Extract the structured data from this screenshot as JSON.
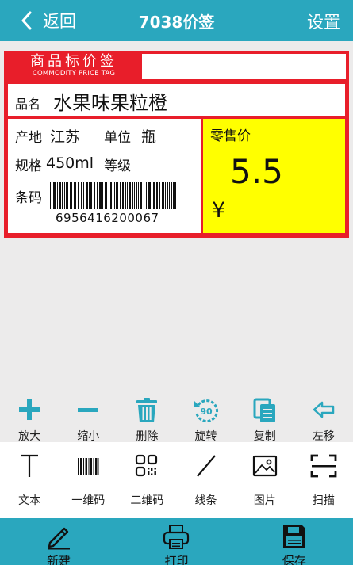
{
  "header": {
    "back_label": "返回",
    "title": "7038价签",
    "settings_label": "设置"
  },
  "tag": {
    "header_cn": "商品标价签",
    "header_en": "COMMODITY PRICE TAG",
    "name_label": "品名",
    "name_value": "水果味果粒橙",
    "origin_label": "产地",
    "origin_value": "江苏",
    "unit_label": "单位",
    "unit_value": "瓶",
    "spec_label": "规格",
    "spec_value": "450ml",
    "grade_label": "等级",
    "barcode_label": "条码",
    "barcode_digits": "6956416200067",
    "price_label": "零售价",
    "price_value": "5.5",
    "currency_symbol": "¥"
  },
  "edit_toolbar": [
    {
      "label": "放大",
      "icon": "plus-icon"
    },
    {
      "label": "缩小",
      "icon": "minus-icon"
    },
    {
      "label": "删除",
      "icon": "trash-icon"
    },
    {
      "label": "旋转",
      "icon": "rotate-90-icon",
      "badge": "90"
    },
    {
      "label": "复制",
      "icon": "copy-icon"
    },
    {
      "label": "左移",
      "icon": "arrow-left-icon"
    }
  ],
  "insert_toolbar": [
    {
      "label": "文本",
      "icon": "text-icon"
    },
    {
      "label": "一维码",
      "icon": "barcode-icon"
    },
    {
      "label": "二维码",
      "icon": "qrcode-icon"
    },
    {
      "label": "线条",
      "icon": "line-icon"
    },
    {
      "label": "图片",
      "icon": "image-icon"
    },
    {
      "label": "扫描",
      "icon": "scan-icon"
    }
  ],
  "bottom_nav": [
    {
      "label": "新建",
      "icon": "pencil-icon"
    },
    {
      "label": "打印",
      "icon": "printer-icon"
    },
    {
      "label": "保存",
      "icon": "save-icon"
    }
  ],
  "colors": {
    "header_bg": "#2aa7be",
    "accent": "#2aa7be",
    "tag_red": "#e81e2a",
    "price_yellow": "#ffff00"
  }
}
